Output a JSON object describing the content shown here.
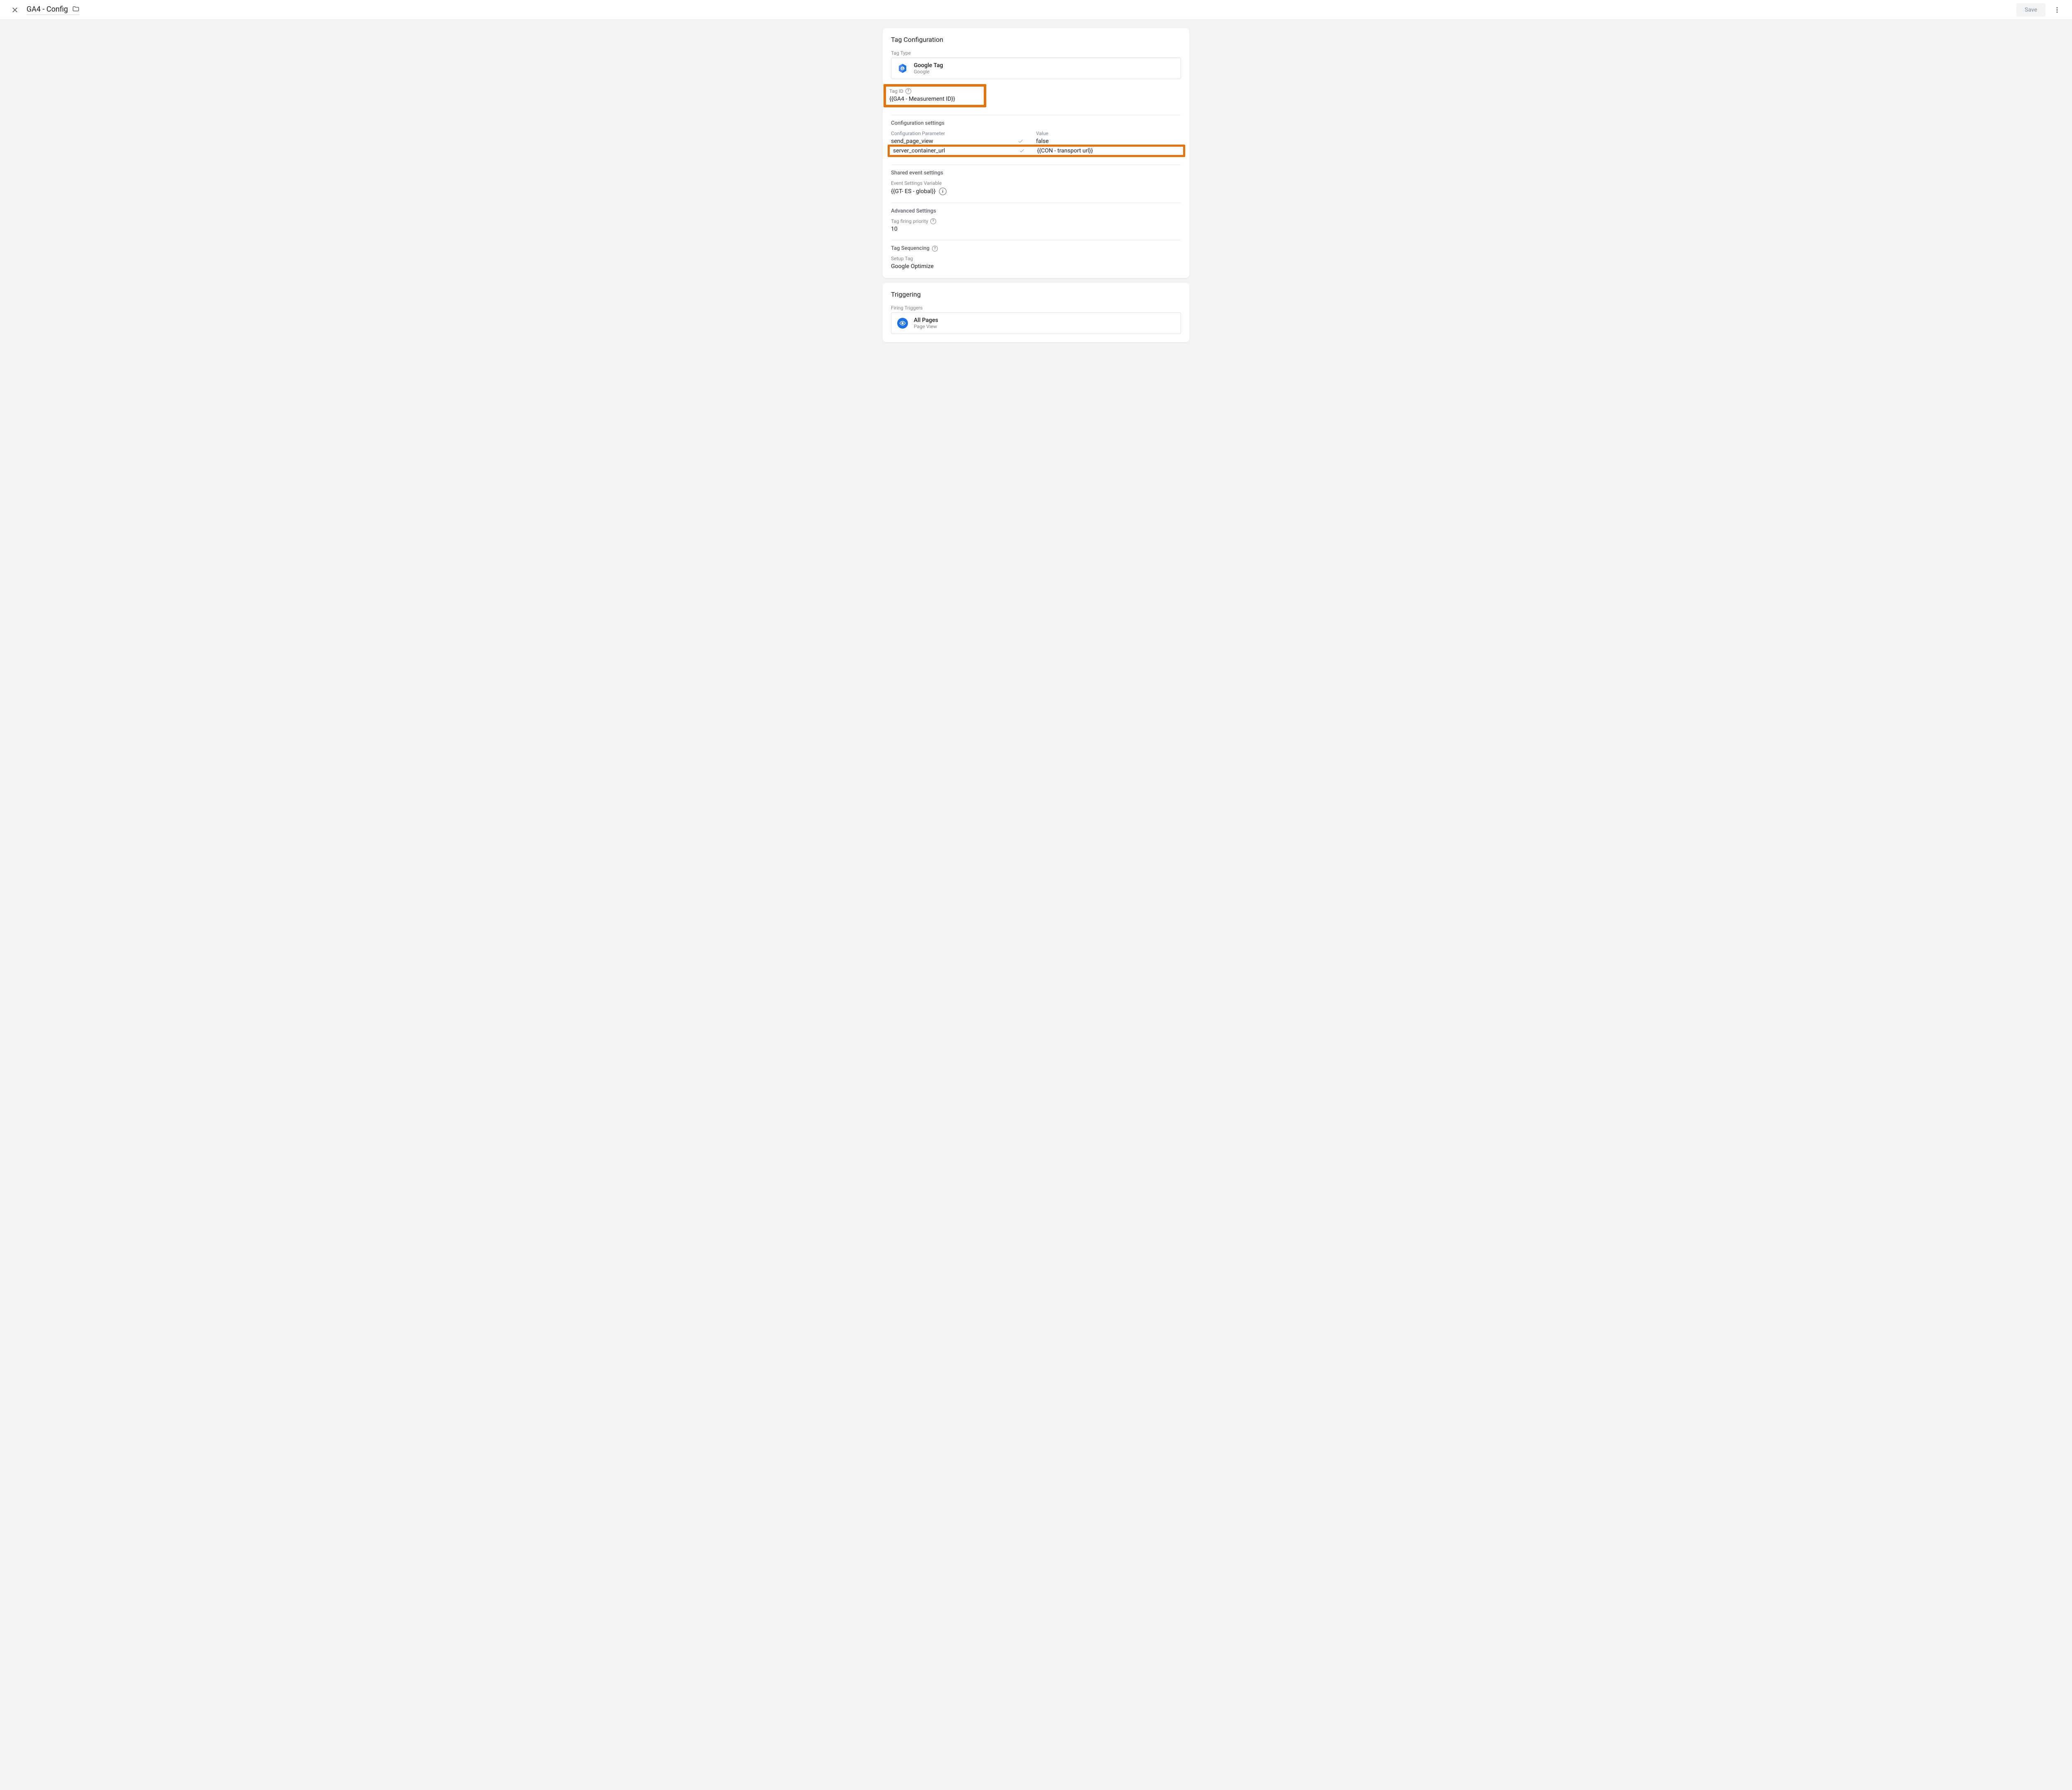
{
  "header": {
    "title": "GA4 - Config",
    "save_label": "Save"
  },
  "tag_config": {
    "card_title": "Tag Configuration",
    "tag_type_label": "Tag Type",
    "tag_type_name": "Google Tag",
    "tag_type_vendor": "Google",
    "tag_id_label": "Tag ID",
    "tag_id_value": "{{GA4 - Measurement ID}}",
    "config_settings_title": "Configuration settings",
    "col_param_header": "Configuration Parameter",
    "col_value_header": "Value",
    "rows": [
      {
        "param": "send_page_view",
        "value": "false"
      },
      {
        "param": "server_container_url",
        "value": "{{CON - transport url}}"
      }
    ],
    "shared_event_title": "Shared event settings",
    "event_settings_label": "Event Settings Variable",
    "event_settings_value": "{{GT- ES - global}}",
    "advanced_title": "Advanced Settings",
    "tag_firing_priority_label": "Tag firing priority",
    "tag_firing_priority_value": "10",
    "tag_sequencing_title": "Tag Sequencing",
    "setup_tag_label": "Setup Tag",
    "setup_tag_value": "Google Optimize"
  },
  "triggering": {
    "card_title": "Triggering",
    "firing_triggers_label": "Firing Triggers",
    "trigger_name": "All Pages",
    "trigger_type": "Page View"
  }
}
